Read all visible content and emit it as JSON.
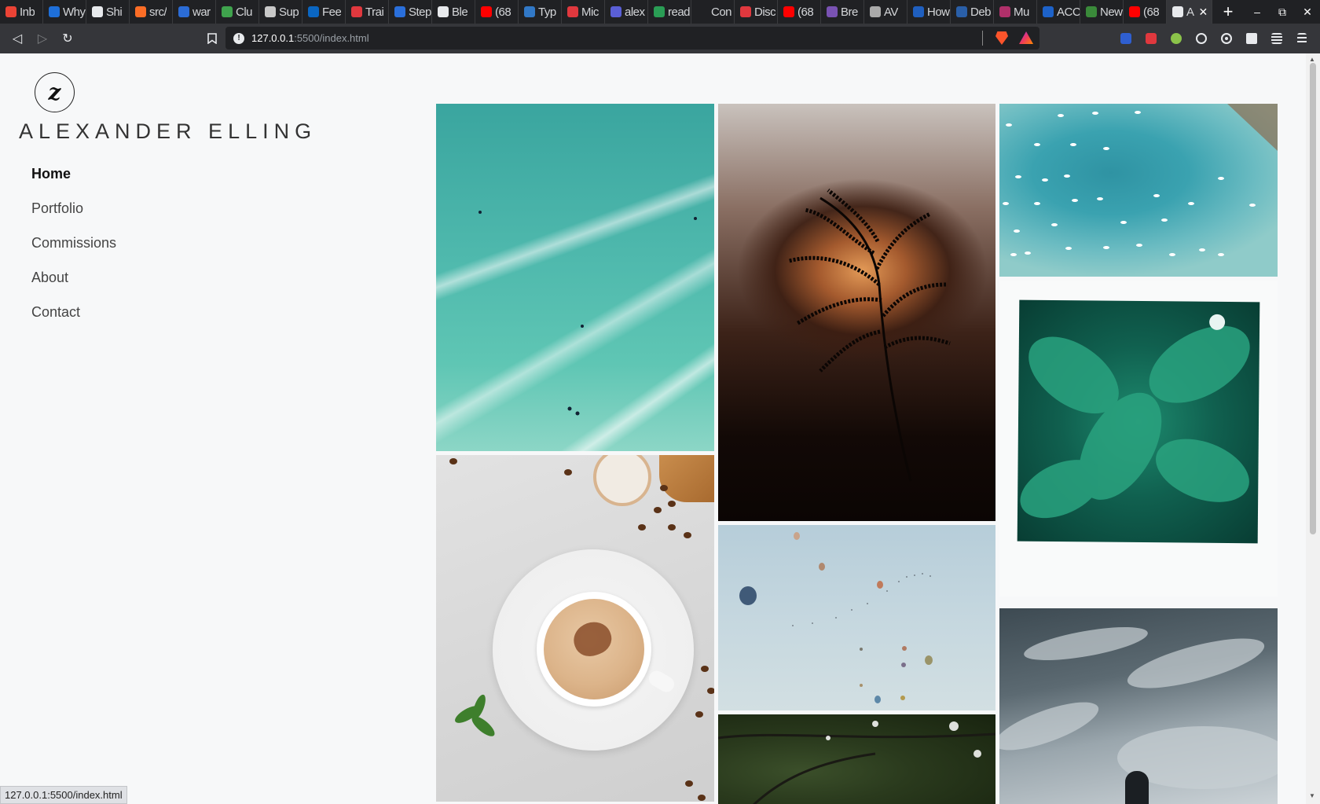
{
  "browser": {
    "tabs": [
      {
        "label": "Inb",
        "icon": "gmail-icon",
        "color": "#ea4335"
      },
      {
        "label": "Why",
        "icon": "chat-icon",
        "color": "#1e6fd9"
      },
      {
        "label": "Shi",
        "icon": "github-icon",
        "color": "#e8eaed"
      },
      {
        "label": "src/",
        "icon": "gitlab-icon",
        "color": "#fc6d26"
      },
      {
        "label": "war",
        "icon": "shield-icon",
        "color": "#2b6cd6"
      },
      {
        "label": "Clu",
        "icon": "leaf-icon",
        "color": "#3fa34d"
      },
      {
        "label": "Sup",
        "icon": "openai-icon",
        "color": "#c8c8c8"
      },
      {
        "label": "Fee",
        "icon": "linkedin-icon",
        "color": "#0a66c2"
      },
      {
        "label": "Trai",
        "icon": "square-icon",
        "color": "#e0383e"
      },
      {
        "label": "Step",
        "icon": "wave-icon",
        "color": "#2a6fdb"
      },
      {
        "label": "Ble",
        "icon": "github-icon",
        "color": "#e8eaed"
      },
      {
        "label": "(68",
        "icon": "youtube-icon",
        "color": "#ff0000"
      },
      {
        "label": "Typ",
        "icon": "ts-icon",
        "color": "#3178c6"
      },
      {
        "label": "Mic",
        "icon": "lambda-icon",
        "color": "#e0383e"
      },
      {
        "label": "alex",
        "icon": "flag-icon",
        "color": "#5a5fd6"
      },
      {
        "label": "read",
        "icon": "document-icon",
        "color": "#2a9d55"
      },
      {
        "label": "Con",
        "icon": "blank-icon",
        "color": "#202124"
      },
      {
        "label": "Disc",
        "icon": "lambda-icon",
        "color": "#e0383e"
      },
      {
        "label": "(68",
        "icon": "youtube-icon",
        "color": "#ff0000"
      },
      {
        "label": "Bre",
        "icon": "bootstrap-icon",
        "color": "#7952b3"
      },
      {
        "label": "AV",
        "icon": "spiral-icon",
        "color": "#aaaaaa"
      },
      {
        "label": "How",
        "icon": "bracket-icon",
        "color": "#1f5fbf"
      },
      {
        "label": "Deb",
        "icon": "gear-icon",
        "color": "#2a5fa8"
      },
      {
        "label": "Mu",
        "icon": "circle-icon",
        "color": "#b0306a"
      },
      {
        "label": "ACC",
        "icon": "bookmark-icon",
        "color": "#1d62c9"
      },
      {
        "label": "New",
        "icon": "evernote-icon",
        "color": "#3a8a3a"
      },
      {
        "label": "(68",
        "icon": "youtube-icon",
        "color": "#ff0000"
      },
      {
        "label": "A",
        "icon": "site-logo-icon",
        "color": "#e8eaed",
        "active": true
      }
    ],
    "new_tab": "+",
    "window_controls": {
      "minimize": "–",
      "restore": "⧉",
      "close": "✕"
    },
    "tab_close": "✕",
    "nav": {
      "back": "◁",
      "forward": "▷",
      "reload": "↻",
      "bookmark": "🔖"
    },
    "url_host": "127.0.0.1",
    "url_path": ":5500/index.html",
    "status_text": "127.0.0.1:5500/index.html"
  },
  "site": {
    "logo_glyph": "z",
    "title": "ALEXANDER ELLING",
    "nav": [
      {
        "label": "Home",
        "current": true
      },
      {
        "label": "Portfolio"
      },
      {
        "label": "Commissions"
      },
      {
        "label": "About"
      },
      {
        "label": "Contact"
      }
    ]
  },
  "gallery": [
    {
      "subject": "ocean waves with surfers"
    },
    {
      "subject": "grass silhouette at sunset"
    },
    {
      "subject": "aerial boats in turquoise water"
    },
    {
      "subject": "green leaves with water drops"
    },
    {
      "subject": "latte in white cup with coffee beans"
    },
    {
      "subject": "hot air balloons in sky"
    },
    {
      "subject": "tree canopy"
    },
    {
      "subject": "person under cloudy sky"
    }
  ]
}
